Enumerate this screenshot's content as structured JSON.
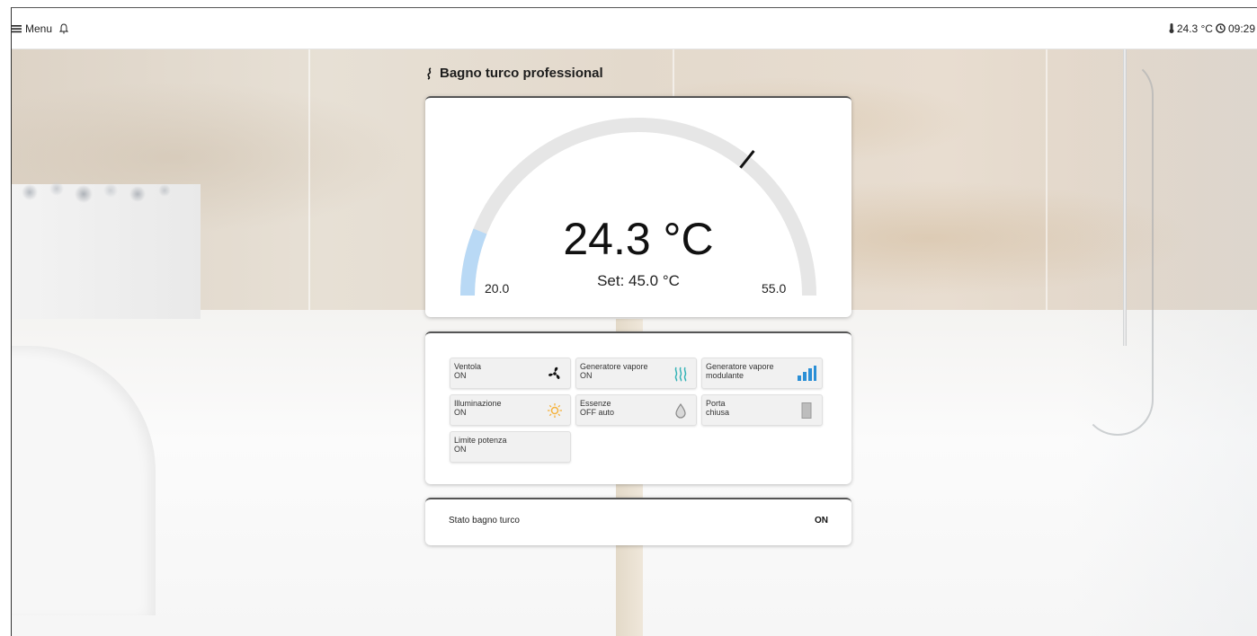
{
  "topbar": {
    "menu_label": "Menu",
    "temperature": "24.3 °C",
    "time": "09:29"
  },
  "page": {
    "title": "Bagno turco professional",
    "title_icon": "steam-icon"
  },
  "gauge": {
    "current_text": "24.3 °C",
    "set_text": "Set: 45.0 °C",
    "min_label": "20.0",
    "max_label": "55.0",
    "min": 20.0,
    "max": 55.0,
    "current": 24.3,
    "setpoint": 45.0,
    "fill_color": "#b9d9f5",
    "track_color": "#e6e6e6",
    "needle_color": "#111111"
  },
  "devices": [
    {
      "line1": "Ventola",
      "line2": "ON",
      "icon": "fan-icon"
    },
    {
      "line1": "Generatore vapore",
      "line2": "ON",
      "icon": "steam-waves-icon"
    },
    {
      "line1": "Generatore vapore",
      "line2": "modulante",
      "icon": "signal-bars-icon"
    },
    {
      "line1": "Illuminazione",
      "line2": "ON",
      "icon": "sun-icon"
    },
    {
      "line1": "Essenze",
      "line2": "OFF auto",
      "icon": "drop-icon"
    },
    {
      "line1": "Porta",
      "line2": "chiusa",
      "icon": "door-icon"
    },
    {
      "line1": "Limite potenza",
      "line2": "ON",
      "icon": ""
    }
  ],
  "status": {
    "label": "Stato bagno turco",
    "value": "ON"
  },
  "colors": {
    "accent_blue": "#2b8fd6",
    "steam_teal": "#35b3b7",
    "sun_orange": "#f5b23c"
  }
}
